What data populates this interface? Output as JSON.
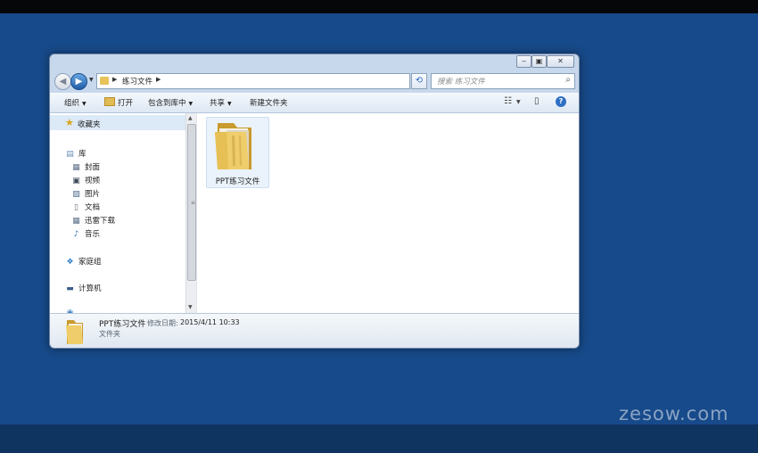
{
  "window": {
    "address": {
      "crumbs": [
        "练习文件"
      ]
    },
    "search": {
      "placeholder": "搜索 练习文件"
    },
    "toolbar": {
      "organize": "组织",
      "open": "打开",
      "include_in_library": "包含到库中",
      "share": "共享",
      "new_folder": "新建文件夹"
    },
    "nav": {
      "favorites": "收藏夹",
      "libraries": "库",
      "library_items": [
        "封面",
        "视频",
        "图片",
        "文档",
        "迅雷下载",
        "音乐"
      ],
      "homegroup": "家庭组",
      "computer": "计算机"
    },
    "files": [
      {
        "name": "PPT练习文件"
      }
    ],
    "details": {
      "name": "PPT练习文件",
      "date_label": "修改日期:",
      "date_value": "2015/4/11 10:33",
      "type": "文件夹"
    }
  },
  "watermark": "zesow.com",
  "colors": {
    "desktop": "#174a8a",
    "top_bar": "#050709",
    "folder": "#e8c35a",
    "selection": "#eaf2fb"
  }
}
